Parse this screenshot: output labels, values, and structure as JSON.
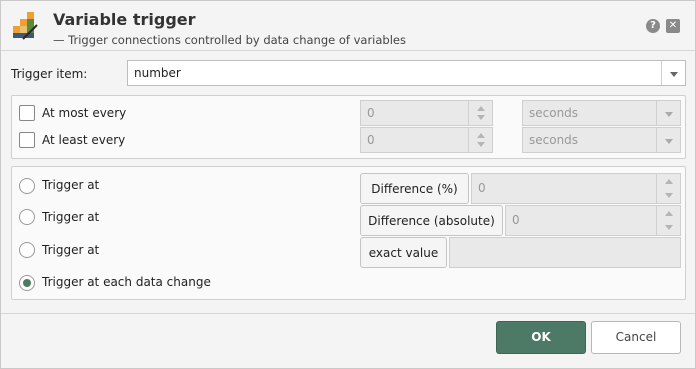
{
  "header": {
    "title": "Variable trigger",
    "subtitle": "— Trigger connections controlled by data change of variables",
    "help_label": "?",
    "close_label": "✕"
  },
  "trigger_item": {
    "label": "Trigger item:",
    "value": "number"
  },
  "interval": {
    "at_most": {
      "label": "At most every",
      "checked": false,
      "value": "0",
      "unit": "seconds"
    },
    "at_least": {
      "label": "At least every",
      "checked": false,
      "value": "0",
      "unit": "seconds"
    }
  },
  "triggers": [
    {
      "label": "Trigger at",
      "mode": "Difference (%)",
      "value": "0",
      "selected": false
    },
    {
      "label": "Trigger at",
      "mode": "Difference (absolute)",
      "value": "0",
      "selected": false
    },
    {
      "label": "Trigger at",
      "mode": "exact value",
      "value": "",
      "selected": false
    },
    {
      "label": "Trigger at each data change",
      "selected": true
    }
  ],
  "buttons": {
    "ok": "OK",
    "cancel": "Cancel"
  },
  "colors": {
    "accent": "#4d7a66",
    "logo_orange": "#f0a030",
    "logo_green": "#5a8a3a"
  }
}
